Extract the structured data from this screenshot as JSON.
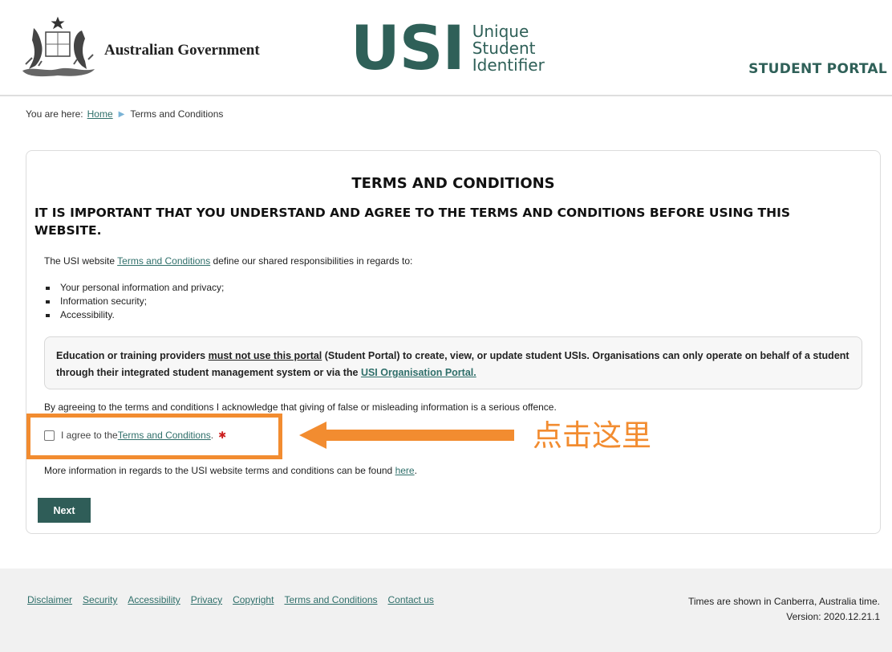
{
  "header": {
    "gov_name": "Australian Government",
    "usi_letters": "USI",
    "usi_sub": [
      "Unique",
      "Student",
      "Identifier"
    ],
    "portal_label": "STUDENT PORTAL"
  },
  "breadcrumb": {
    "prefix": "You are here:",
    "home": "Home",
    "current": "Terms and Conditions"
  },
  "card": {
    "title": "TERMS AND CONDITIONS",
    "warning": "IT IS IMPORTANT THAT YOU UNDERSTAND AND AGREE TO THE TERMS AND CONDITIONS BEFORE USING THIS WEBSITE.",
    "intro_pre": "The USI website ",
    "intro_link": "Terms and Conditions",
    "intro_post": " define our shared responsibilities in regards to:",
    "bullets": [
      "Your personal information and privacy;",
      "Information security;",
      "Accessibility."
    ],
    "notice_pre": "Education or training providers ",
    "notice_emph": "must not use this portal",
    "notice_mid": " (Student Portal) to create, view, or update student USIs. Organisations can only operate on behalf of a student through their integrated student management system or via the ",
    "notice_link": "USI Organisation Portal.",
    "ack": "By agreeing to the terms and conditions I acknowledge that giving of false or misleading information is a serious offence.",
    "agree_pre": "I agree to the ",
    "agree_link": "Terms and Conditions",
    "agree_post": ".",
    "required_mark": "✱",
    "more_pre": "More information in regards to the USI website terms and conditions can be found ",
    "more_link": "here",
    "more_post": ".",
    "next_label": "Next"
  },
  "annotation": {
    "text": "点击这里",
    "color": "#f28c30"
  },
  "footer": {
    "links": [
      "Disclaimer",
      "Security",
      "Accessibility",
      "Privacy",
      "Copyright",
      "Terms and Conditions",
      "Contact us"
    ],
    "time_note": "Times are shown in Canberra, Australia time.",
    "version": "Version: 2020.12.21.1"
  },
  "colors": {
    "brand": "#2f6058",
    "link": "#2f6f6a",
    "button": "#2f5d58"
  }
}
